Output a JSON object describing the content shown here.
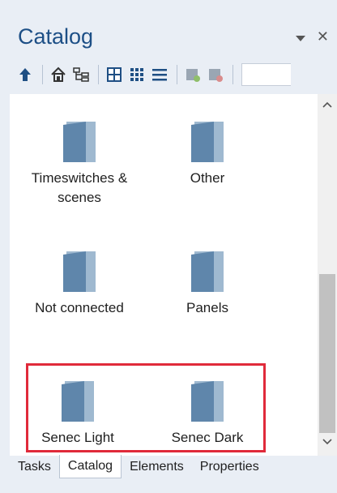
{
  "panel": {
    "title": "Catalog"
  },
  "toolbar": {
    "buttons": [
      "up-icon",
      "home-icon",
      "tree-view-icon",
      "large-icons-icon",
      "small-icons-icon",
      "list-view-icon",
      "add-item-icon",
      "remove-item-icon"
    ]
  },
  "items": [
    {
      "label": "Timeswitches &\nscenes"
    },
    {
      "label": "Other"
    },
    {
      "label": "Not connected"
    },
    {
      "label": "Panels"
    },
    {
      "label": "Senec Light"
    },
    {
      "label": "Senec Dark"
    }
  ],
  "tabs": [
    {
      "label": "Tasks"
    },
    {
      "label": "Catalog",
      "active": true
    },
    {
      "label": "Elements"
    },
    {
      "label": "Properties"
    }
  ],
  "colors": {
    "title": "#1d4f86",
    "folder": "#5f86ab",
    "highlight": "#e02a3a"
  }
}
